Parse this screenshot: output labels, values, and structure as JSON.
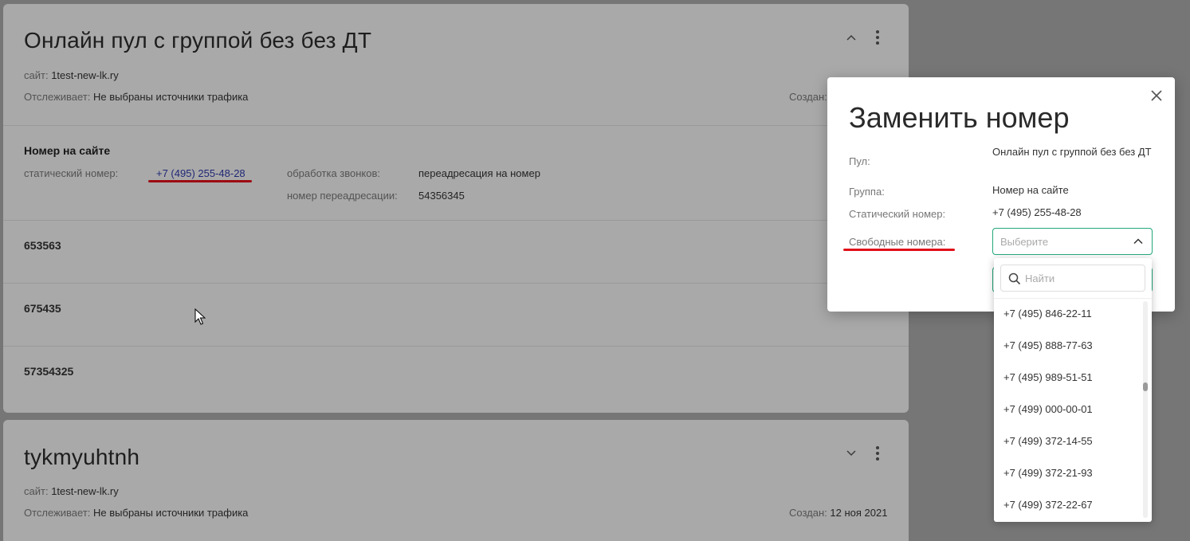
{
  "pools": [
    {
      "title": "Онлайн пул с группой без без ДТ",
      "site_label": "сайт:",
      "site_value": "1test-new-lk.ry",
      "tracks_label": "Отслеживает:",
      "tracks_value": "Не выбраны источники трафика",
      "created_label": "Создан:",
      "created_value": "",
      "group": {
        "title": "Номер на сайте",
        "static_label": "статический номер:",
        "static_value": "+7 (495) 255-48-28",
        "processing_label": "обработка звонков:",
        "processing_value": "переадресация на номер",
        "forward_label": "номер переадресации:",
        "forward_value": "54356345"
      },
      "numbers": [
        "653563",
        "675435",
        "57354325"
      ]
    },
    {
      "title": "tykmyuhtnh",
      "site_label": "сайт:",
      "site_value": "1test-new-lk.ry",
      "tracks_label": "Отслеживает:",
      "tracks_value": "Не выбраны источники трафика",
      "created_label": "Создан:",
      "created_value": "12 ноя 2021"
    }
  ],
  "modal": {
    "title": "Заменить номер",
    "pool_label": "Пул:",
    "pool_value": "Онлайн пул с группой без без ДТ",
    "group_label": "Группа:",
    "group_value": "Номер на сайте",
    "static_label": "Статический номер:",
    "static_value": "+7 (495) 255-48-28",
    "free_label": "Свободные номера:",
    "select_placeholder": "Выберите",
    "search_placeholder": "Найти",
    "options": [
      "+7 (495) 846-22-11",
      "+7 (495) 888-77-63",
      "+7 (495) 989-51-51",
      "+7 (499) 000-00-01",
      "+7 (499) 372-14-55",
      "+7 (499) 372-21-93",
      "+7 (499) 372-22-67"
    ]
  },
  "colors": {
    "accent": "#23a77a",
    "link": "#2f3aa8",
    "annotation_red": "#e0101a"
  },
  "icons": [
    "chevron-up-icon",
    "chevron-down-icon",
    "kebab-menu-icon",
    "close-icon",
    "search-icon",
    "mouse-cursor-icon"
  ]
}
